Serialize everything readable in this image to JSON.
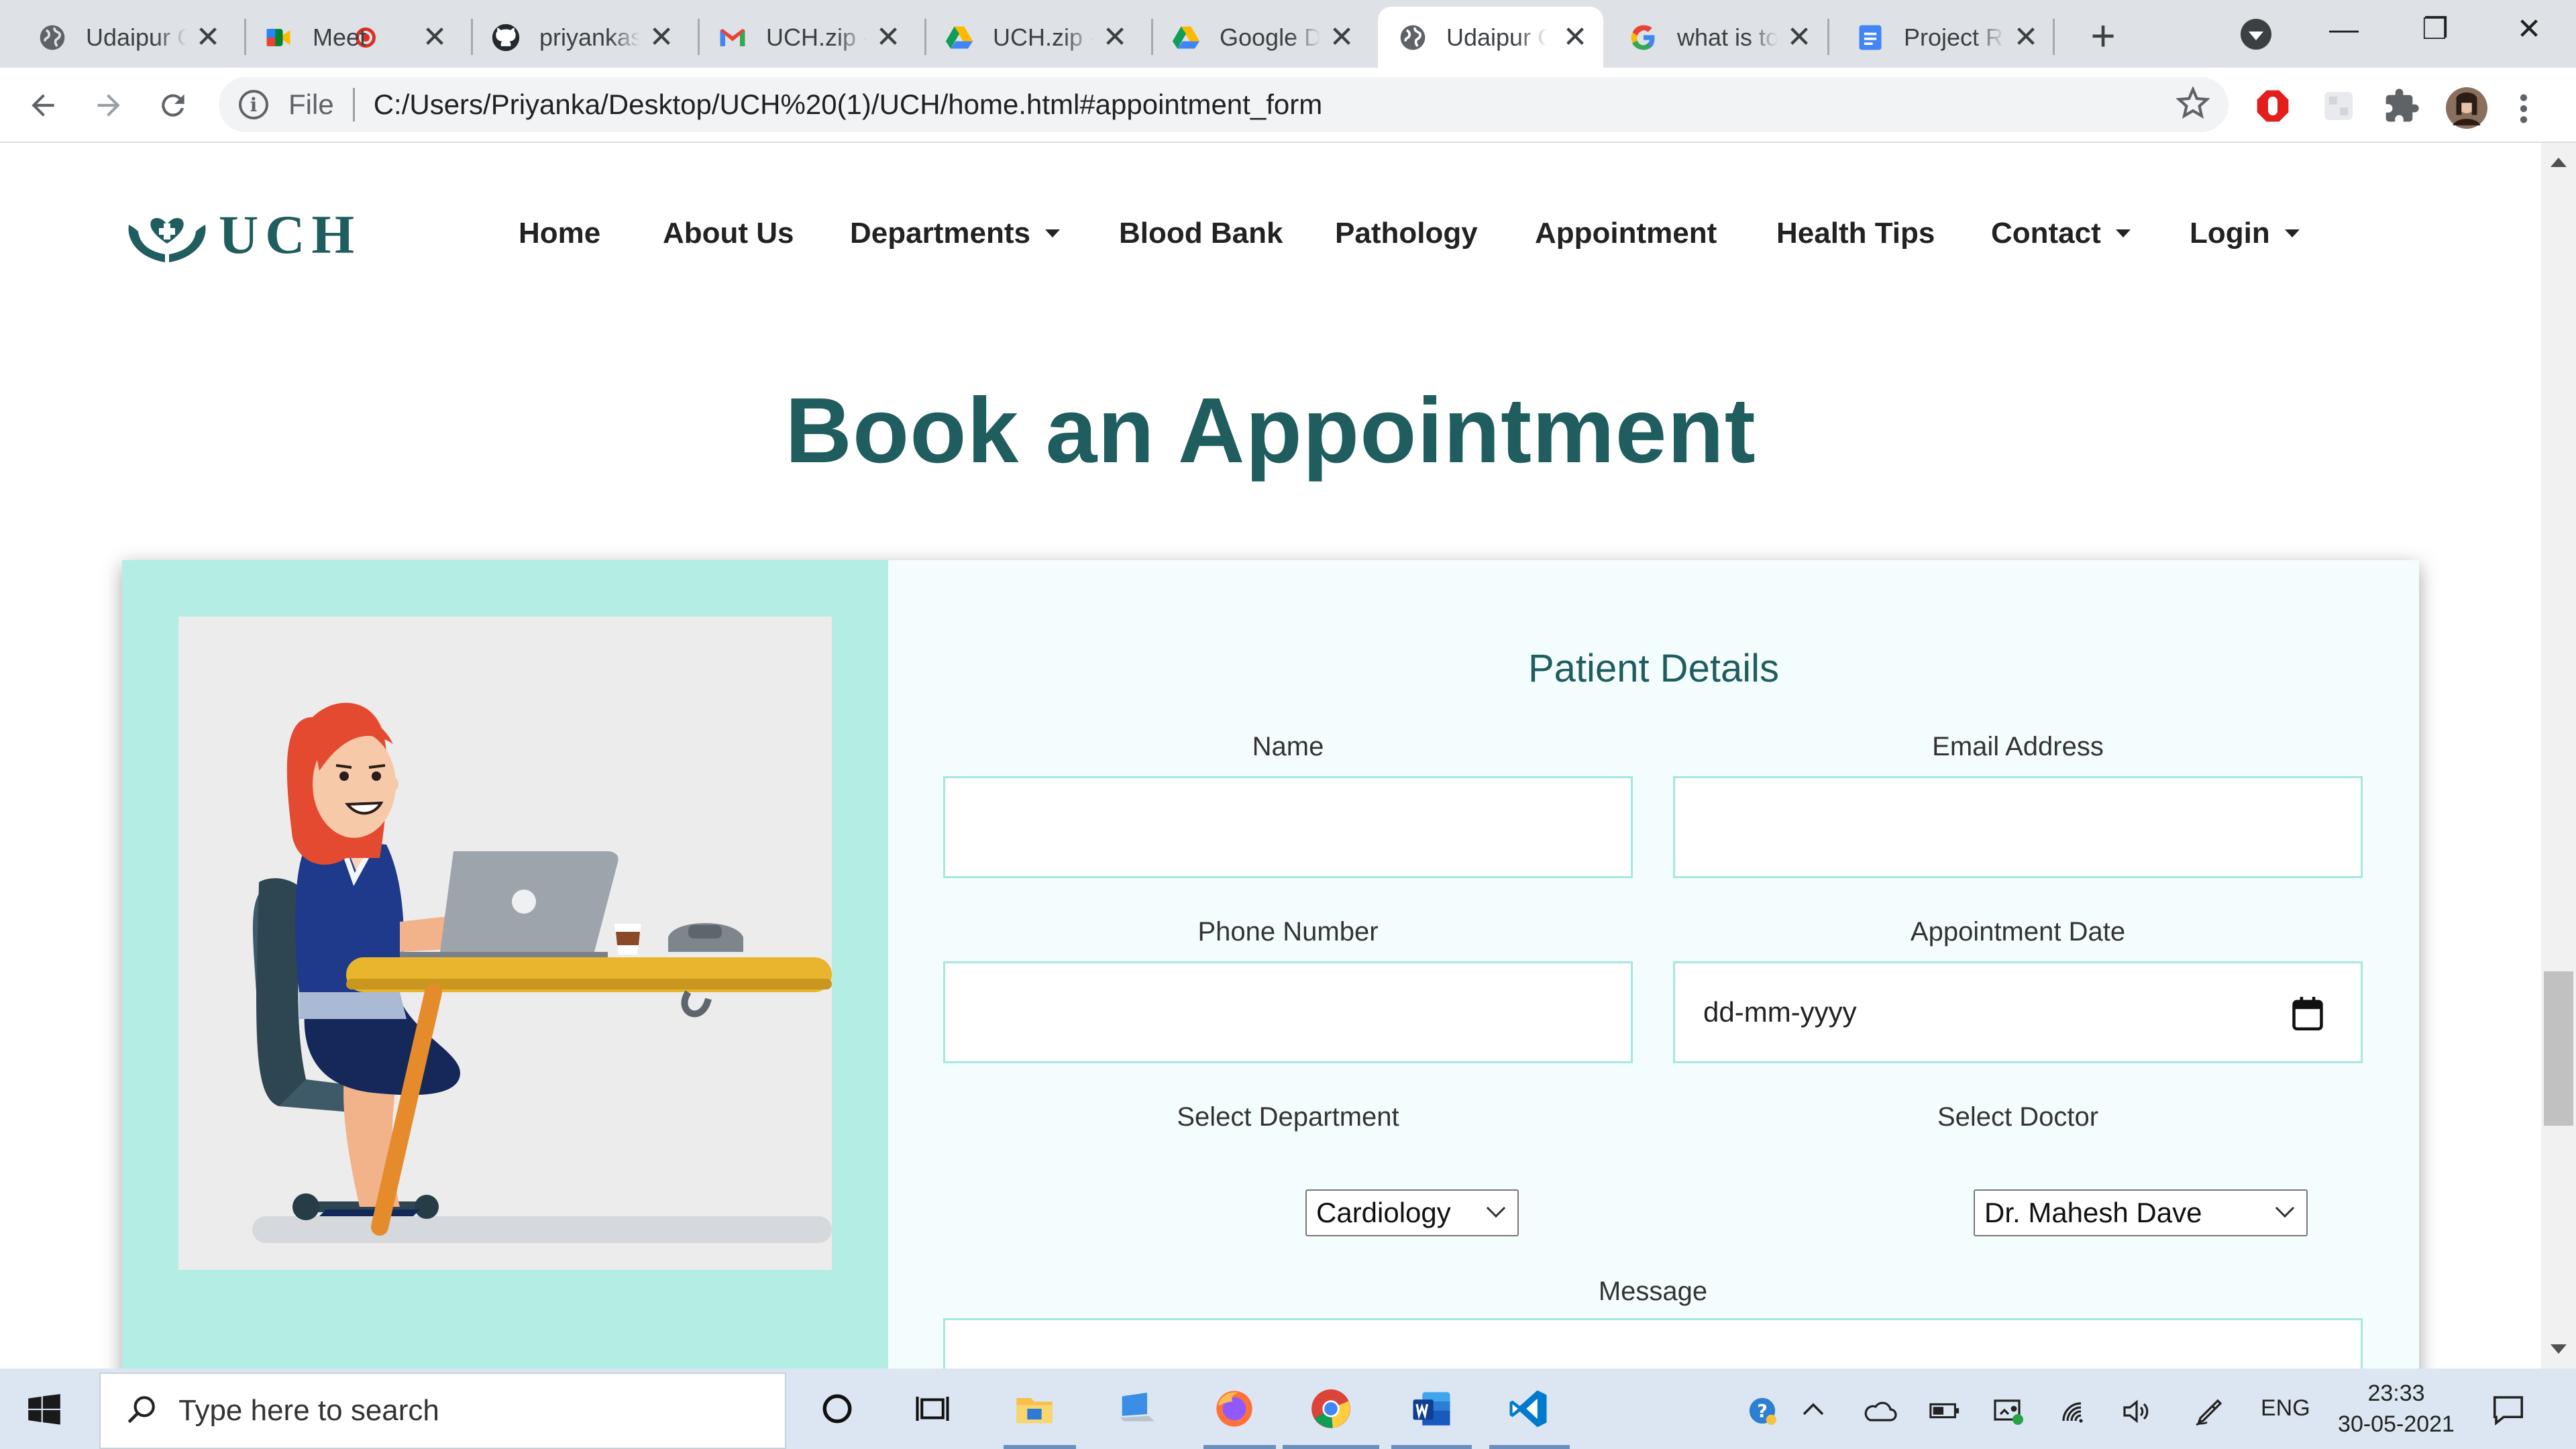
{
  "browser": {
    "tabs": [
      {
        "title": "Udaipur Chest Hospital",
        "icon": "globe-icon",
        "active": false
      },
      {
        "title": "Meet",
        "icon": "google-meet-icon",
        "recording": true,
        "active": false
      },
      {
        "title": "priyankasen",
        "icon": "github-icon",
        "active": false
      },
      {
        "title": "UCH.zip - priyanka",
        "icon": "gmail-icon",
        "active": false
      },
      {
        "title": "UCH.zip - Google Drive",
        "icon": "google-drive-icon",
        "active": false
      },
      {
        "title": "Google Drive",
        "icon": "google-drive-icon",
        "active": false
      },
      {
        "title": "Udaipur Chest Hospital",
        "icon": "globe-icon",
        "active": true
      },
      {
        "title": "what is to",
        "icon": "google-icon",
        "active": false
      },
      {
        "title": "Project Report",
        "icon": "google-docs-icon",
        "active": false
      }
    ],
    "new_tab_label": "+",
    "close_glyph": "✕",
    "window_controls": {
      "minimize": "—",
      "restore": "❐",
      "close": "✕"
    },
    "address": {
      "scheme_label": "File",
      "url": "C:/Users/Priyanka/Desktop/UCH%20(1)/UCH/home.html#appointment_form"
    }
  },
  "site": {
    "logo_text": "UCH",
    "nav": [
      {
        "label": "Home",
        "dropdown": false
      },
      {
        "label": "About Us",
        "dropdown": false
      },
      {
        "label": "Departments",
        "dropdown": true
      },
      {
        "label": "Blood Bank",
        "dropdown": false
      },
      {
        "label": "Pathology",
        "dropdown": false
      },
      {
        "label": "Appointment",
        "dropdown": false
      },
      {
        "label": "Health Tips",
        "dropdown": false
      },
      {
        "label": "Contact",
        "dropdown": true
      },
      {
        "label": "Login",
        "dropdown": true
      }
    ],
    "headline": "Book an Appointment",
    "form": {
      "title": "Patient Details",
      "name_label": "Name",
      "name_value": "",
      "email_label": "Email Address",
      "email_value": "",
      "phone_label": "Phone Number",
      "phone_value": "",
      "date_label": "Appointment Date",
      "date_placeholder": "dd-mm-yyyy",
      "department_label": "Select Department",
      "department_value": "Cardiology",
      "doctor_label": "Select Doctor",
      "doctor_value": "Dr. Mahesh Dave",
      "message_label": "Message",
      "message_value": ""
    },
    "colors": {
      "brand": "#1f5d5e",
      "panel": "#b3ede3",
      "field_border": "#a8e6e0"
    }
  },
  "taskbar": {
    "search_placeholder": "Type here to search",
    "language": "ENG",
    "time": "23:33",
    "date": "30-05-2021",
    "pinned": [
      "cortana-icon",
      "task-view-icon",
      "file-explorer-icon",
      "this-pc-icon",
      "firefox-icon",
      "chrome-icon",
      "word-icon",
      "vscode-icon"
    ]
  }
}
